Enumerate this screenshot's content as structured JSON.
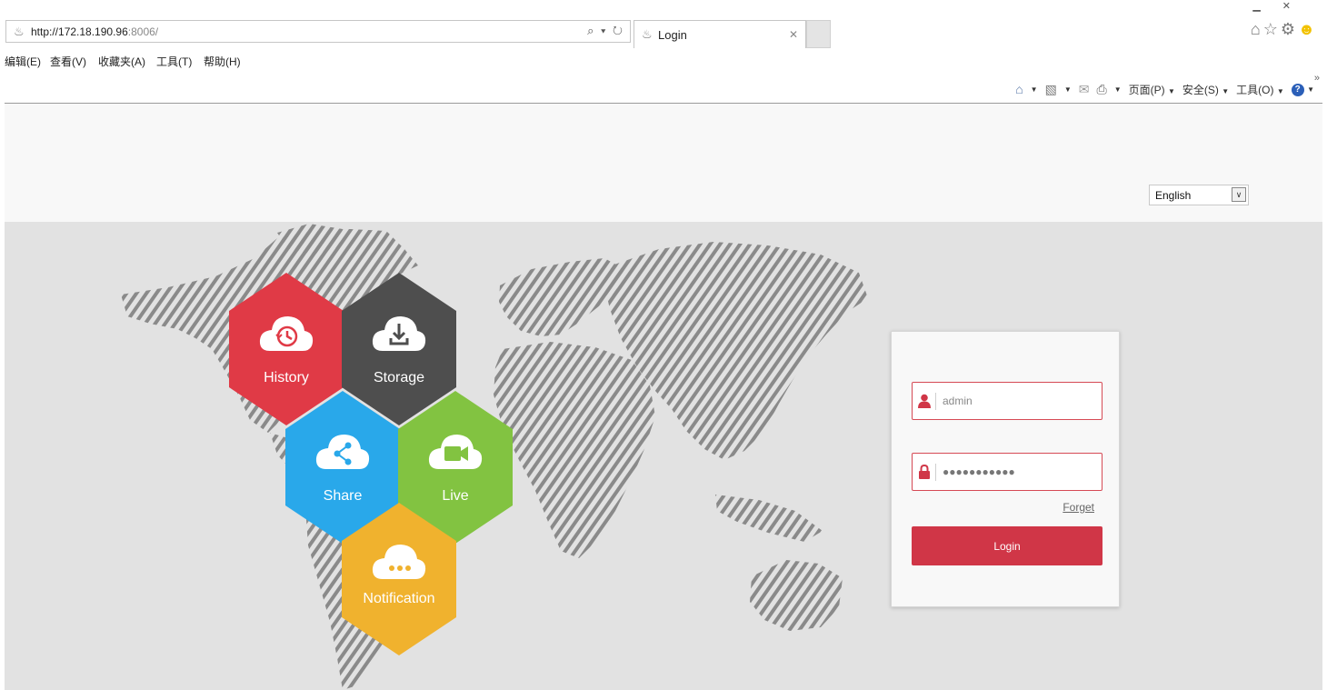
{
  "browser": {
    "url_host": "http://172.18.190.96",
    "url_port": ":8006/",
    "tab_title": "Login",
    "menu": [
      "编辑(E)",
      "查看(V)",
      "收藏夹(A)",
      "工具(T)",
      "帮助(H)"
    ],
    "command_bar": {
      "page": "页面(P)",
      "safety": "安全(S)",
      "tools": "工具(O)"
    }
  },
  "page": {
    "language": "English",
    "tiles": [
      {
        "label": "History",
        "icon": "history-clock-icon",
        "color": "#e03a46"
      },
      {
        "label": "Storage",
        "icon": "download-icon",
        "color": "#4e4e4e"
      },
      {
        "label": "Share",
        "icon": "share-icon",
        "color": "#29a8ea"
      },
      {
        "label": "Live",
        "icon": "video-camera-icon",
        "color": "#82c341"
      },
      {
        "label": "Notification",
        "icon": "ellipsis-icon",
        "color": "#f0b22e"
      }
    ],
    "login": {
      "username_placeholder": "admin",
      "password_value": "●●●●●●●●●●●",
      "forget_label": "Forget",
      "login_label": "Login",
      "accent_color": "#d03647"
    }
  }
}
